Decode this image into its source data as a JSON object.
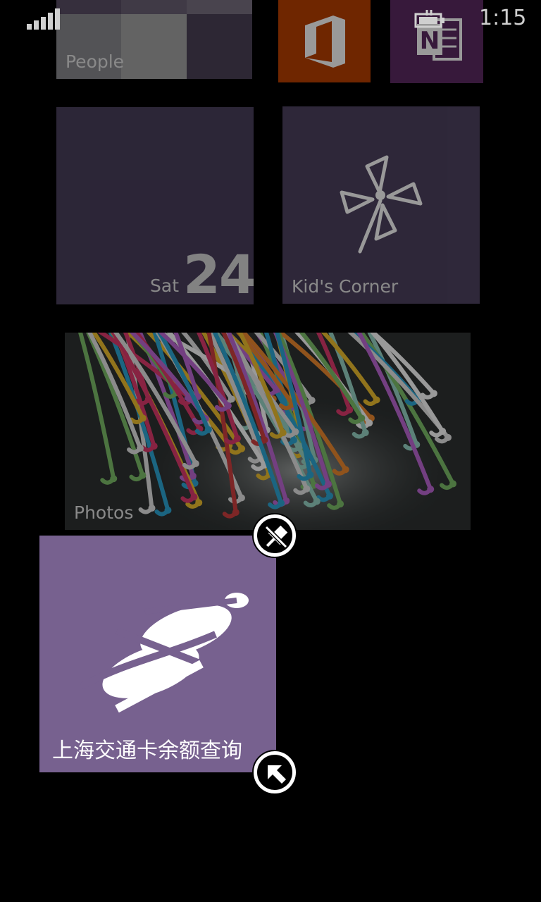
{
  "status_bar": {
    "time": "1:15",
    "signal_icon": "signal-strength-icon",
    "battery_icon": "battery-charging-icon"
  },
  "tiles": {
    "people": {
      "label": "People",
      "icon": "people-icon"
    },
    "office": {
      "icon": "office-icon",
      "color": "#b94000"
    },
    "onenote": {
      "icon": "onenote-icon",
      "color": "#5d2a63"
    },
    "calendar": {
      "day": "Sat",
      "date": "24"
    },
    "kids_corner": {
      "label": "Kid's Corner",
      "icon": "pinwheel-icon"
    },
    "photos": {
      "label": "Photos"
    },
    "transit_card": {
      "label": "上海交通卡余额查询",
      "icon": "metro-logo-icon",
      "color": "#77618f"
    }
  },
  "edit_controls": {
    "unpin_icon": "unpin-icon",
    "resize_icon": "resize-arrow-icon"
  },
  "colors": {
    "background": "#000000",
    "accent": "#77618f"
  }
}
